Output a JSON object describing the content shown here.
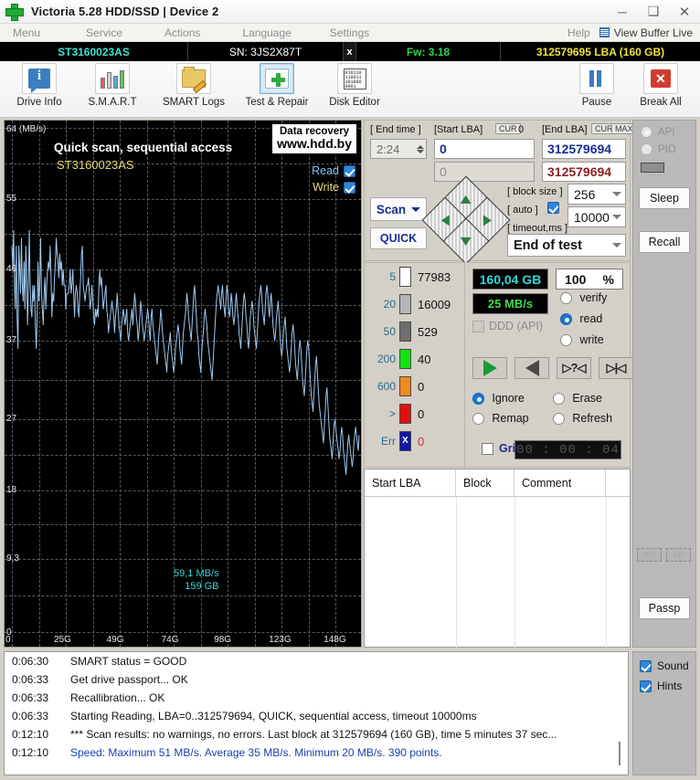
{
  "window": {
    "title": "Victoria 5.28 HDD/SSD | Device 2",
    "minimize": "─",
    "maximize": "❑",
    "close": "✕"
  },
  "menu": {
    "items": [
      "Menu",
      "Service",
      "Actions",
      "Language",
      "Settings",
      "Help"
    ],
    "view_buffer_live": "View Buffer Live"
  },
  "drive_bar": {
    "model": "ST3160023AS",
    "serial": "SN: 3JS2X87T",
    "close_mark": "x",
    "firmware": "Fw: 3.18",
    "capacity": "312579695 LBA (160 GB)"
  },
  "toolbar": {
    "buttons": [
      {
        "label": "Drive Info",
        "icon": "info-icon"
      },
      {
        "label": "S.M.A.R.T",
        "icon": "smart-bars-icon"
      },
      {
        "label": "SMART Logs",
        "icon": "folder-pencil-icon"
      },
      {
        "label": "Test & Repair",
        "icon": "medkit-cross-icon"
      },
      {
        "label": "Disk Editor",
        "icon": "hex-binary-icon"
      }
    ],
    "right_buttons": [
      {
        "label": "Pause",
        "icon": "pause-icon"
      },
      {
        "label": "Break All",
        "icon": "stop-x-icon"
      }
    ],
    "hex_glyph": "010110\n110011\n101000\n0001"
  },
  "chart_data": {
    "type": "line",
    "title": "Quick scan, sequential access",
    "subtitle": "ST3160023AS",
    "xlabel": "",
    "ylabel": "64 (MB/s)",
    "ylim": [
      0,
      64
    ],
    "xlim": [
      0,
      160
    ],
    "grid": true,
    "yticks": [
      "64 (MB/s)",
      "55",
      "46",
      "37",
      "27",
      "18",
      "9,3",
      "0"
    ],
    "ytick_values": [
      64,
      55,
      46,
      37,
      27,
      18,
      9.3,
      0
    ],
    "xticks": [
      "0",
      "25G",
      "49G",
      "74G",
      "98G",
      "123G",
      "148G"
    ],
    "xtick_values": [
      0,
      25,
      49,
      74,
      98,
      123,
      148
    ],
    "legend": [
      {
        "name": "Read",
        "checked": true,
        "color": "#7cc7f2"
      },
      {
        "name": "Write",
        "checked": true,
        "color": "#e6d97a"
      }
    ],
    "annotations": [
      "59,1 MB/s",
      "159 GB"
    ],
    "watermark": {
      "line1": "Data recovery",
      "line2": "www.hdd.by"
    },
    "series": [
      {
        "name": "Read",
        "color": "#9ec9f0",
        "values": [
          49,
          46,
          51,
          44,
          41,
          49,
          40,
          36,
          49,
          46,
          43,
          50,
          44,
          42,
          47,
          41,
          49,
          45,
          39,
          44,
          51,
          44,
          41,
          40,
          44,
          42,
          44,
          39,
          36,
          40,
          47,
          42,
          44,
          50,
          43,
          41,
          39,
          43,
          45,
          41,
          44,
          46,
          47,
          46,
          49,
          45,
          40,
          43,
          42,
          45,
          47,
          50,
          48,
          47,
          45,
          48,
          46,
          47,
          44,
          46,
          44,
          44,
          41,
          43,
          43,
          43,
          44,
          46,
          43,
          44,
          46,
          43,
          40,
          43,
          44,
          43,
          41,
          40,
          43,
          45,
          48,
          49,
          44,
          43,
          42,
          43,
          44,
          44,
          45,
          43,
          41,
          42,
          44,
          42,
          40,
          39,
          41,
          40,
          41,
          40,
          44,
          46,
          44,
          45,
          43,
          41,
          42,
          43,
          44,
          41,
          40,
          38,
          39,
          40,
          41,
          42,
          41,
          40,
          38,
          40,
          41,
          43,
          41,
          39,
          38,
          37,
          39,
          40,
          41,
          40,
          39,
          40,
          41,
          38,
          37,
          38,
          39,
          40,
          41,
          39,
          41,
          43,
          42,
          40,
          39,
          37,
          38,
          40,
          42,
          41,
          39,
          38,
          37,
          38,
          39,
          40,
          41,
          40,
          38,
          37,
          40,
          41,
          39,
          38,
          37,
          36,
          35,
          34,
          36,
          38,
          39,
          41,
          40,
          38,
          37,
          36,
          35,
          34,
          33,
          35,
          36,
          37,
          38,
          36,
          35,
          34,
          33,
          34,
          36,
          37,
          38,
          39,
          38,
          36,
          35,
          34,
          36,
          38,
          39,
          40,
          41,
          43,
          42,
          40,
          39,
          38,
          37,
          39,
          41,
          43,
          44,
          42,
          40,
          38,
          37,
          35,
          34,
          33,
          35,
          37,
          38,
          40,
          41,
          40,
          39,
          37,
          36,
          35,
          34,
          33,
          32,
          34,
          36,
          38,
          40,
          42,
          43,
          44,
          43,
          42,
          41,
          43,
          44,
          42,
          41,
          40,
          42,
          44,
          43,
          41,
          40,
          41,
          43,
          42,
          40,
          39,
          40,
          42,
          43,
          41,
          40,
          38,
          37,
          36,
          38,
          40,
          42,
          43,
          42,
          40,
          39,
          37,
          36,
          38,
          40,
          41,
          42,
          41,
          39,
          38,
          37,
          36,
          38,
          40,
          42,
          43,
          44,
          43,
          41,
          40,
          39,
          41,
          43,
          44,
          43,
          41,
          40,
          42,
          43,
          41,
          39,
          38,
          37,
          38,
          40,
          41,
          42,
          40,
          38,
          36,
          35,
          36,
          38,
          39,
          40,
          38,
          36,
          35,
          34,
          33,
          34,
          36,
          38,
          39,
          38,
          36,
          34,
          33,
          32,
          34,
          36,
          37,
          36,
          34,
          32,
          31,
          30,
          32,
          34,
          36,
          37,
          36,
          34,
          32,
          30,
          29,
          28,
          30,
          32,
          34,
          35,
          33,
          31,
          29,
          28,
          27,
          26,
          25,
          24,
          26,
          28,
          30,
          31,
          29,
          27,
          25,
          24,
          23,
          22,
          24,
          26,
          27,
          26,
          25,
          24,
          23,
          22,
          23,
          25,
          26,
          25,
          23,
          22,
          21,
          20,
          22,
          24,
          25,
          24,
          23,
          22,
          21,
          22,
          24,
          25,
          26,
          25,
          24,
          23,
          25
        ]
      }
    ]
  },
  "scan_params": {
    "end_time_label": "[ End time ]",
    "end_time_value": "2:24",
    "start_lba_label": "[Start LBA]",
    "start_lba_cur": "CUR",
    "start_lba_cur_value": "0",
    "start_lba_value": "0",
    "start_lba_value2": "0",
    "end_lba_label": "[End LBA]",
    "end_lba_cur": "CUR",
    "end_lba_max": "MAX",
    "end_lba_value": "312579694",
    "end_lba_value2": "312579694",
    "scan_button": "Scan",
    "quick_button": "QUICK",
    "block_size_label": "[ block size ]",
    "block_size_value": "256",
    "auto_label": "[ auto ]",
    "auto_checked": true,
    "timeout_label": "[ timeout,ms ]",
    "timeout_value": "10000",
    "end_of_test_value": "End of test"
  },
  "block_stats": [
    {
      "threshold": "5",
      "color": "#ffffff",
      "count": "77983"
    },
    {
      "threshold": "20",
      "color": "#b5b5b5",
      "count": "16009"
    },
    {
      "threshold": "50",
      "color": "#6e6e6e",
      "count": "529"
    },
    {
      "threshold": "200",
      "color": "#12e212",
      "count": "40"
    },
    {
      "threshold": "600",
      "color": "#f08a1e",
      "count": "0"
    },
    {
      "threshold": ">",
      "color": "#e01010",
      "count": "0"
    },
    {
      "threshold": "Err",
      "color": "#1015a8",
      "count": "0"
    }
  ],
  "controls": {
    "size_value": "160,04 GB",
    "percent_value": "100",
    "percent_unit": "%",
    "speed_value": "25 MB/s",
    "ddd_label": "DDD (API)",
    "ddd_checked": false,
    "modes": [
      {
        "label": "verify",
        "selected": false
      },
      {
        "label": "read",
        "selected": true
      },
      {
        "label": "write",
        "selected": false
      }
    ],
    "transport": [
      {
        "name": "play-forward-button",
        "glyph": "▶"
      },
      {
        "name": "play-backward-button",
        "glyph": "◀"
      },
      {
        "name": "step-query-button",
        "glyph": "?"
      },
      {
        "name": "step-end-button",
        "glyph": "|"
      }
    ],
    "actions": [
      {
        "label": "Ignore",
        "selected": true
      },
      {
        "label": "Erase",
        "selected": false
      },
      {
        "label": "Remap",
        "selected": false
      },
      {
        "label": "Refresh",
        "selected": false
      }
    ],
    "grid_label": "Grid",
    "grid_checked": false,
    "timer": "00 : 00 : 04"
  },
  "defect_table": {
    "columns": [
      "Start LBA",
      "Block",
      "Comment"
    ],
    "rows": []
  },
  "sidebar": {
    "api_label": "API",
    "api_selected": true,
    "pio_label": "PIO",
    "pio_selected": false,
    "sleep_button": "Sleep",
    "recall_button": "Recall",
    "wr_button": "WR",
    "rd_button": "RD",
    "passp_button": "Passp"
  },
  "log": {
    "entries": [
      {
        "time": "0:06:30",
        "message": "SMART status = GOOD",
        "highlight": false
      },
      {
        "time": "0:06:33",
        "message": "Get drive passport... OK",
        "highlight": false
      },
      {
        "time": "0:06:33",
        "message": "Recallibration... OK",
        "highlight": false
      },
      {
        "time": "0:06:33",
        "message": "Starting Reading, LBA=0..312579694, QUICK, sequential access, timeout 10000ms",
        "highlight": false
      },
      {
        "time": "0:12:10",
        "message": "*** Scan results: no warnings, no errors. Last block at 312579694 (160 GB), time 5 minutes 37 sec...",
        "highlight": false
      },
      {
        "time": "0:12:10",
        "message": "Speed: Maximum 51 MB/s. Average 35 MB/s. Minimum 20 MB/s. 390 points.",
        "highlight": true
      }
    ]
  },
  "bottom_options": [
    {
      "label": "Sound",
      "checked": true
    },
    {
      "label": "Hints",
      "checked": true
    }
  ],
  "colors": {
    "accent_blue": "#1a2f8f",
    "chart_line": "#9ec9f0",
    "cyan": "#30d8d8",
    "green": "#3ddc4a",
    "yellow": "#f0e040"
  }
}
